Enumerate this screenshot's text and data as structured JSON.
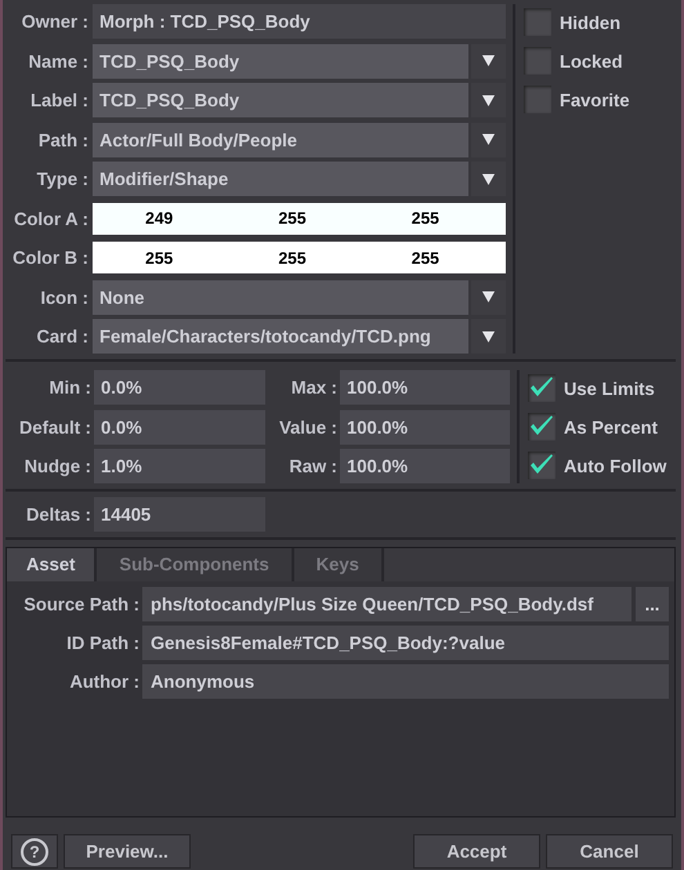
{
  "properties": [
    {
      "kind": "text",
      "label": "Owner :",
      "value": "Morph : TCD_PSQ_Body"
    },
    {
      "kind": "dropdown",
      "label": "Name :",
      "value": "TCD_PSQ_Body"
    },
    {
      "kind": "dropdown",
      "label": "Label :",
      "value": "TCD_PSQ_Body"
    },
    {
      "kind": "dropdown",
      "label": "Path :",
      "value": "Actor/Full Body/People"
    },
    {
      "kind": "dropdown",
      "label": "Type :",
      "value": "Modifier/Shape"
    },
    {
      "kind": "color",
      "label": "Color A :",
      "values": [
        "249",
        "255",
        "255"
      ],
      "color": "#f9ffff"
    },
    {
      "kind": "color",
      "label": "Color B :",
      "values": [
        "255",
        "255",
        "255"
      ],
      "color": "#ffffff"
    },
    {
      "kind": "dropdown",
      "label": "Icon :",
      "value": "None"
    },
    {
      "kind": "dropdown",
      "label": "Card :",
      "value": "Female/Characters/totocandy/TCD.png"
    }
  ],
  "flags": [
    {
      "label": "Hidden",
      "checked": false
    },
    {
      "label": "Locked",
      "checked": false
    },
    {
      "label": "Favorite",
      "checked": false
    }
  ],
  "limits": [
    {
      "label": "Min :",
      "value": "0.0%",
      "label2": "Max :",
      "value2": "100.0%"
    },
    {
      "label": "Default :",
      "value": "0.0%",
      "label2": "Value :",
      "value2": "100.0%"
    },
    {
      "label": "Nudge :",
      "value": "1.0%",
      "label2": "Raw :",
      "value2": "100.0%"
    }
  ],
  "limit_options": [
    {
      "label": "Use Limits",
      "checked": true
    },
    {
      "label": "As Percent",
      "checked": true
    },
    {
      "label": "Auto Follow",
      "checked": true
    }
  ],
  "deltas": {
    "label": "Deltas :",
    "value": "14405"
  },
  "tabs": [
    {
      "label": "Asset",
      "selected": true
    },
    {
      "label": "Sub-Components",
      "selected": false
    },
    {
      "label": "Keys",
      "selected": false
    }
  ],
  "asset": [
    {
      "label": "Source Path :",
      "value": "phs/totocandy/Plus Size Queen/TCD_PSQ_Body.dsf",
      "browse": "..."
    },
    {
      "label": "ID Path :",
      "value": "Genesis8Female#TCD_PSQ_Body:?value"
    },
    {
      "label": "Author :",
      "value": "Anonymous"
    }
  ],
  "buttons": {
    "help": "?",
    "preview": "Preview...",
    "accept": "Accept",
    "cancel": "Cancel"
  }
}
